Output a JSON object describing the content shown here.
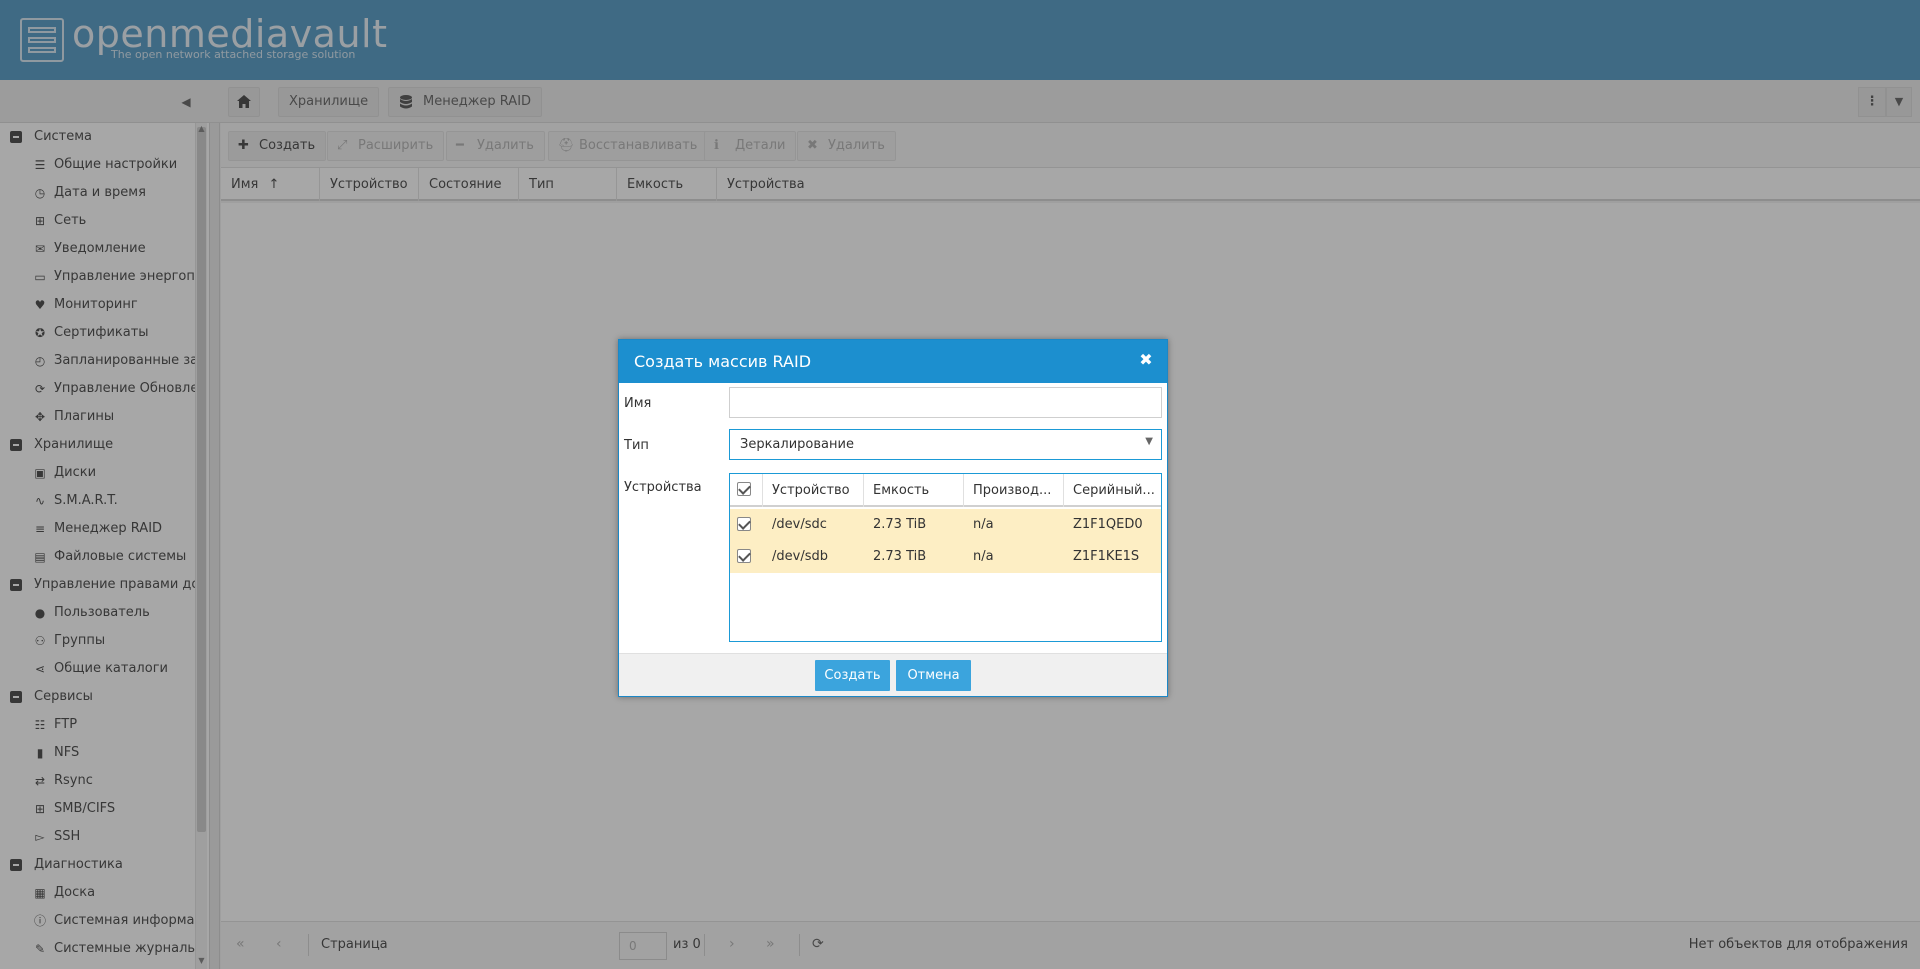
{
  "header": {
    "logo_name": "openmediavault",
    "logo_tagline": "The open network attached storage solution"
  },
  "breadcrumbs": {
    "home_icon": "home-icon",
    "items": [
      "Хранилище",
      "Менеджер RAID"
    ]
  },
  "sidebar": {
    "items": [
      {
        "type": "group",
        "label": "Система"
      },
      {
        "type": "child",
        "label": "Общие настройки",
        "icon": "sliders-icon"
      },
      {
        "type": "child",
        "label": "Дата и время",
        "icon": "clock-icon"
      },
      {
        "type": "child",
        "label": "Сеть",
        "icon": "network-icon"
      },
      {
        "type": "child",
        "label": "Уведомление",
        "icon": "envelope-icon"
      },
      {
        "type": "child",
        "label": "Управление энергопотреблением",
        "icon": "battery-icon"
      },
      {
        "type": "child",
        "label": "Мониторинг",
        "icon": "heartbeat-icon"
      },
      {
        "type": "child",
        "label": "Сертификаты",
        "icon": "certificate-icon"
      },
      {
        "type": "child",
        "label": "Запланированные задачи",
        "icon": "alarm-icon"
      },
      {
        "type": "child",
        "label": "Управление Обновлениями",
        "icon": "refresh-icon"
      },
      {
        "type": "child",
        "label": "Плагины",
        "icon": "puzzle-icon"
      },
      {
        "type": "group",
        "label": "Хранилище"
      },
      {
        "type": "child",
        "label": "Диски",
        "icon": "disk-icon"
      },
      {
        "type": "child",
        "label": "S.M.A.R.T.",
        "icon": "pulse-icon"
      },
      {
        "type": "child",
        "label": "Менеджер RAID",
        "icon": "database-icon"
      },
      {
        "type": "child",
        "label": "Файловые системы",
        "icon": "files-icon"
      },
      {
        "type": "group",
        "label": "Управление правами доступа"
      },
      {
        "type": "child",
        "label": "Пользователь",
        "icon": "user-icon"
      },
      {
        "type": "child",
        "label": "Группы",
        "icon": "users-icon"
      },
      {
        "type": "child",
        "label": "Общие каталоги",
        "icon": "share-icon"
      },
      {
        "type": "group",
        "label": "Сервисы"
      },
      {
        "type": "child",
        "label": "FTP",
        "icon": "server-icon"
      },
      {
        "type": "child",
        "label": "NFS",
        "icon": "desktop-icon"
      },
      {
        "type": "child",
        "label": "Rsync",
        "icon": "sync-icon"
      },
      {
        "type": "child",
        "label": "SMB/CIFS",
        "icon": "windows-icon"
      },
      {
        "type": "child",
        "label": "SSH",
        "icon": "terminal-icon"
      },
      {
        "type": "group",
        "label": "Диагностика"
      },
      {
        "type": "child",
        "label": "Доска",
        "icon": "dashboard-icon"
      },
      {
        "type": "child",
        "label": "Системная информация",
        "icon": "info-icon"
      },
      {
        "type": "child",
        "label": "Системные журналы",
        "icon": "edit-icon"
      }
    ]
  },
  "actions": {
    "create": "Создать",
    "grow": "Расширить",
    "remove": "Удалить",
    "recover": "Восстанавливать",
    "details": "Детали",
    "delete": "Удалить"
  },
  "grid": {
    "columns": [
      "Имя",
      "Устройство",
      "Состояние",
      "Тип",
      "Емкость",
      "Устройства"
    ],
    "sort_indicator": "↑"
  },
  "pager": {
    "page_label": "Страница",
    "page_value": "0",
    "of_label": "из 0",
    "status": "Нет объектов для отображения"
  },
  "dialog": {
    "title": "Создать массив RAID",
    "name_label": "Имя",
    "name_value": "",
    "type_label": "Тип",
    "type_value": "Зеркалирование",
    "devices_label": "Устройства",
    "device_columns": [
      "Устройство",
      "Емкость",
      "Производ...",
      "Серийный..."
    ],
    "devices": [
      {
        "device": "/dev/sdc",
        "capacity": "2.73 TiB",
        "vendor": "n/a",
        "serial": "Z1F1QED0",
        "checked": true
      },
      {
        "device": "/dev/sdb",
        "capacity": "2.73 TiB",
        "vendor": "n/a",
        "serial": "Z1F1KE1S",
        "checked": true
      }
    ],
    "create_button": "Создать",
    "cancel_button": "Отмена"
  },
  "colors": {
    "header": "#4390c0",
    "dialog_header": "#1c8fcf",
    "button": "#3ba4dd",
    "selected_row": "#fdeec4"
  }
}
